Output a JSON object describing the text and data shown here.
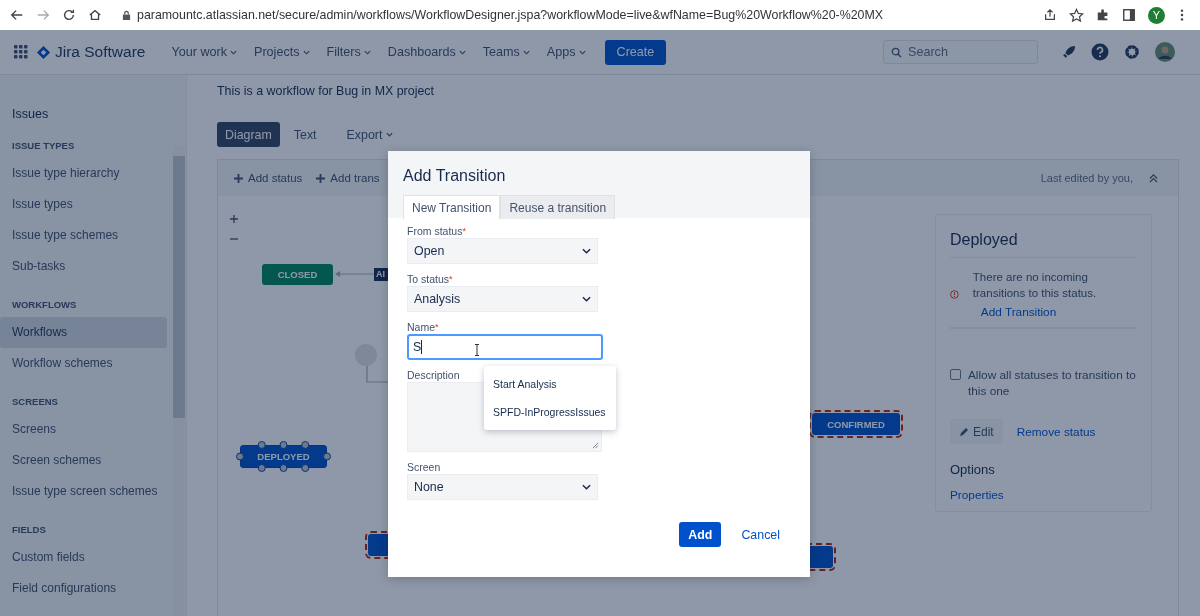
{
  "browser": {
    "url": "paramountc.atlassian.net/secure/admin/workflows/WorkflowDesigner.jspa?workflowMode=live&wfName=Bug%20Workflow%20-%20MX",
    "profile_initial": "Y"
  },
  "nav": {
    "product": "Jira Software",
    "menus": [
      "Your work",
      "Projects",
      "Filters",
      "Dashboards",
      "Teams",
      "Apps"
    ],
    "create": "Create",
    "search_placeholder": "Search"
  },
  "sidebar": {
    "heading": "Issues",
    "sections": [
      {
        "title": "ISSUE TYPES",
        "items": [
          {
            "label": "Issue type hierarchy",
            "selected": false
          },
          {
            "label": "Issue types",
            "selected": false
          },
          {
            "label": "Issue type schemes",
            "selected": false
          },
          {
            "label": "Sub-tasks",
            "selected": false
          }
        ]
      },
      {
        "title": "WORKFLOWS",
        "items": [
          {
            "label": "Workflows",
            "selected": true
          },
          {
            "label": "Workflow schemes",
            "selected": false
          }
        ]
      },
      {
        "title": "SCREENS",
        "items": [
          {
            "label": "Screens",
            "selected": false
          },
          {
            "label": "Screen schemes",
            "selected": false
          },
          {
            "label": "Issue type screen schemes",
            "selected": false
          }
        ]
      },
      {
        "title": "FIELDS",
        "items": [
          {
            "label": "Custom fields",
            "selected": false
          },
          {
            "label": "Field configurations",
            "selected": false
          }
        ]
      }
    ]
  },
  "workflow": {
    "description": "This is a workflow for Bug in MX project",
    "views": [
      {
        "label": "Diagram",
        "selected": true
      },
      {
        "label": "Text",
        "selected": false
      }
    ],
    "export": "Export",
    "toolbar": [
      "Add status",
      "Add trans"
    ],
    "last_edited": "Last edited by you,"
  },
  "diagram": {
    "nodes": [
      {
        "label": "CLOSED",
        "kind": "done",
        "selected": false,
        "highlighted": false
      },
      {
        "label": "AI",
        "kind": "transition-label"
      },
      {
        "label": "DEPLOYED",
        "kind": "progress",
        "selected": true,
        "highlighted": false
      },
      {
        "label": "CONFIRMED",
        "kind": "progress",
        "selected": false,
        "highlighted": true
      },
      {
        "kind": "progress",
        "selected": false,
        "highlighted": true
      },
      {
        "kind": "progress",
        "selected": false,
        "highlighted": true
      }
    ]
  },
  "status_panel": {
    "title": "Deployed",
    "warning": "There are no incoming transitions to this status.",
    "warning_link": "Add Transition",
    "allow_all": {
      "label": "Allow all statuses to transition to this one",
      "checked": false
    },
    "edit": "Edit",
    "remove": "Remove status",
    "options_title": "Options",
    "properties": "Properties"
  },
  "dialog": {
    "title": "Add Transition",
    "tabs": [
      {
        "label": "New Transition",
        "selected": true
      },
      {
        "label": "Reuse a transition",
        "selected": false
      }
    ],
    "required_mark": "*",
    "fields": [
      {
        "kind": "select",
        "label": "From status",
        "required": true,
        "value": "Open"
      },
      {
        "kind": "select",
        "label": "To status",
        "required": true,
        "value": "Analysis"
      },
      {
        "kind": "text",
        "label": "Name",
        "required": true,
        "value": "S",
        "focused": true
      },
      {
        "kind": "textarea",
        "label": "Description",
        "required": false
      },
      {
        "kind": "select",
        "label": "Screen",
        "required": false,
        "value": "None"
      }
    ],
    "suggestions": [
      "Start Analysis",
      "SPFD-InProgressIssues"
    ],
    "primary": "Add",
    "cancel": "Cancel"
  }
}
